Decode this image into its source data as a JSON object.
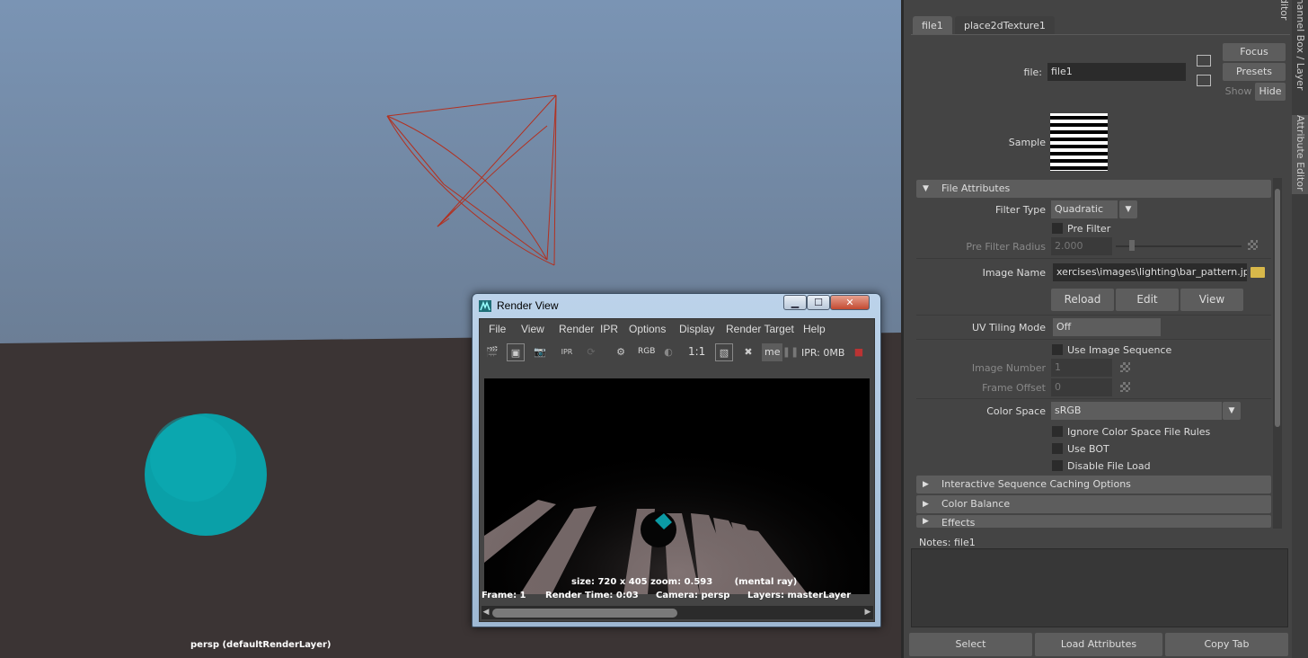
{
  "viewport": {
    "label": "persp (defaultRenderLayer)",
    "sphere_color": "#0aa0a8",
    "camera_wire_color": "#b3301f"
  },
  "render_view": {
    "title": "Render View",
    "window_controls": {
      "minimize": "▁",
      "maximize": "☐",
      "close": "✕"
    },
    "menu": [
      "File",
      "View",
      "Render",
      "IPR",
      "Options",
      "Display",
      "Render Target",
      "Help"
    ],
    "toolbar": {
      "rgb_label": "RGB",
      "ratio_label": "1:1",
      "renderer_short": "me",
      "ipr_memory": "IPR: 0MB"
    },
    "image_size_label": "size: 720 x 405 zoom: 0.593",
    "renderer_label": "(mental ray)",
    "status": {
      "frame": "Frame: 1",
      "render_time": "Render Time: 0:03",
      "camera": "Camera: persp",
      "layers": "Layers: masterLayer"
    }
  },
  "attribute_editor": {
    "tabs": [
      "file1",
      "place2dTexture1"
    ],
    "file_label": "file:",
    "file_value": "file1",
    "focus_button": "Focus",
    "presets_button": "Presets",
    "show_label": "Show",
    "hide_label": "Hide",
    "sample_label": "Sample",
    "file_attributes": {
      "header": "File Attributes",
      "filter_type_label": "Filter Type",
      "filter_type_value": "Quadratic",
      "pre_filter_label": "Pre Filter",
      "pre_filter_radius_label": "Pre Filter Radius",
      "pre_filter_radius_value": "2.000",
      "image_name_label": "Image Name",
      "image_name_value": "xercises\\images\\lighting\\bar_pattern.jpg",
      "reload_button": "Reload",
      "edit_button": "Edit",
      "view_button": "View",
      "uv_tiling_label": "UV Tiling Mode",
      "uv_tiling_value": "Off",
      "use_image_sequence_label": "Use Image Sequence",
      "image_number_label": "Image Number",
      "image_number_value": "1",
      "frame_offset_label": "Frame Offset",
      "frame_offset_value": "0",
      "color_space_label": "Color Space",
      "color_space_value": "sRGB",
      "ignore_color_space_label": "Ignore Color Space File Rules",
      "use_bot_label": "Use BOT",
      "disable_file_load_label": "Disable File Load"
    },
    "collapsed_sections": [
      "Interactive Sequence Caching Options",
      "Color Balance",
      "Effects"
    ],
    "notes_label": "Notes:  file1",
    "bottom_buttons": [
      "Select",
      "Load Attributes",
      "Copy Tab"
    ],
    "side_tabs": [
      "Channel Box / Layer Editor",
      "Attribute Editor"
    ]
  }
}
